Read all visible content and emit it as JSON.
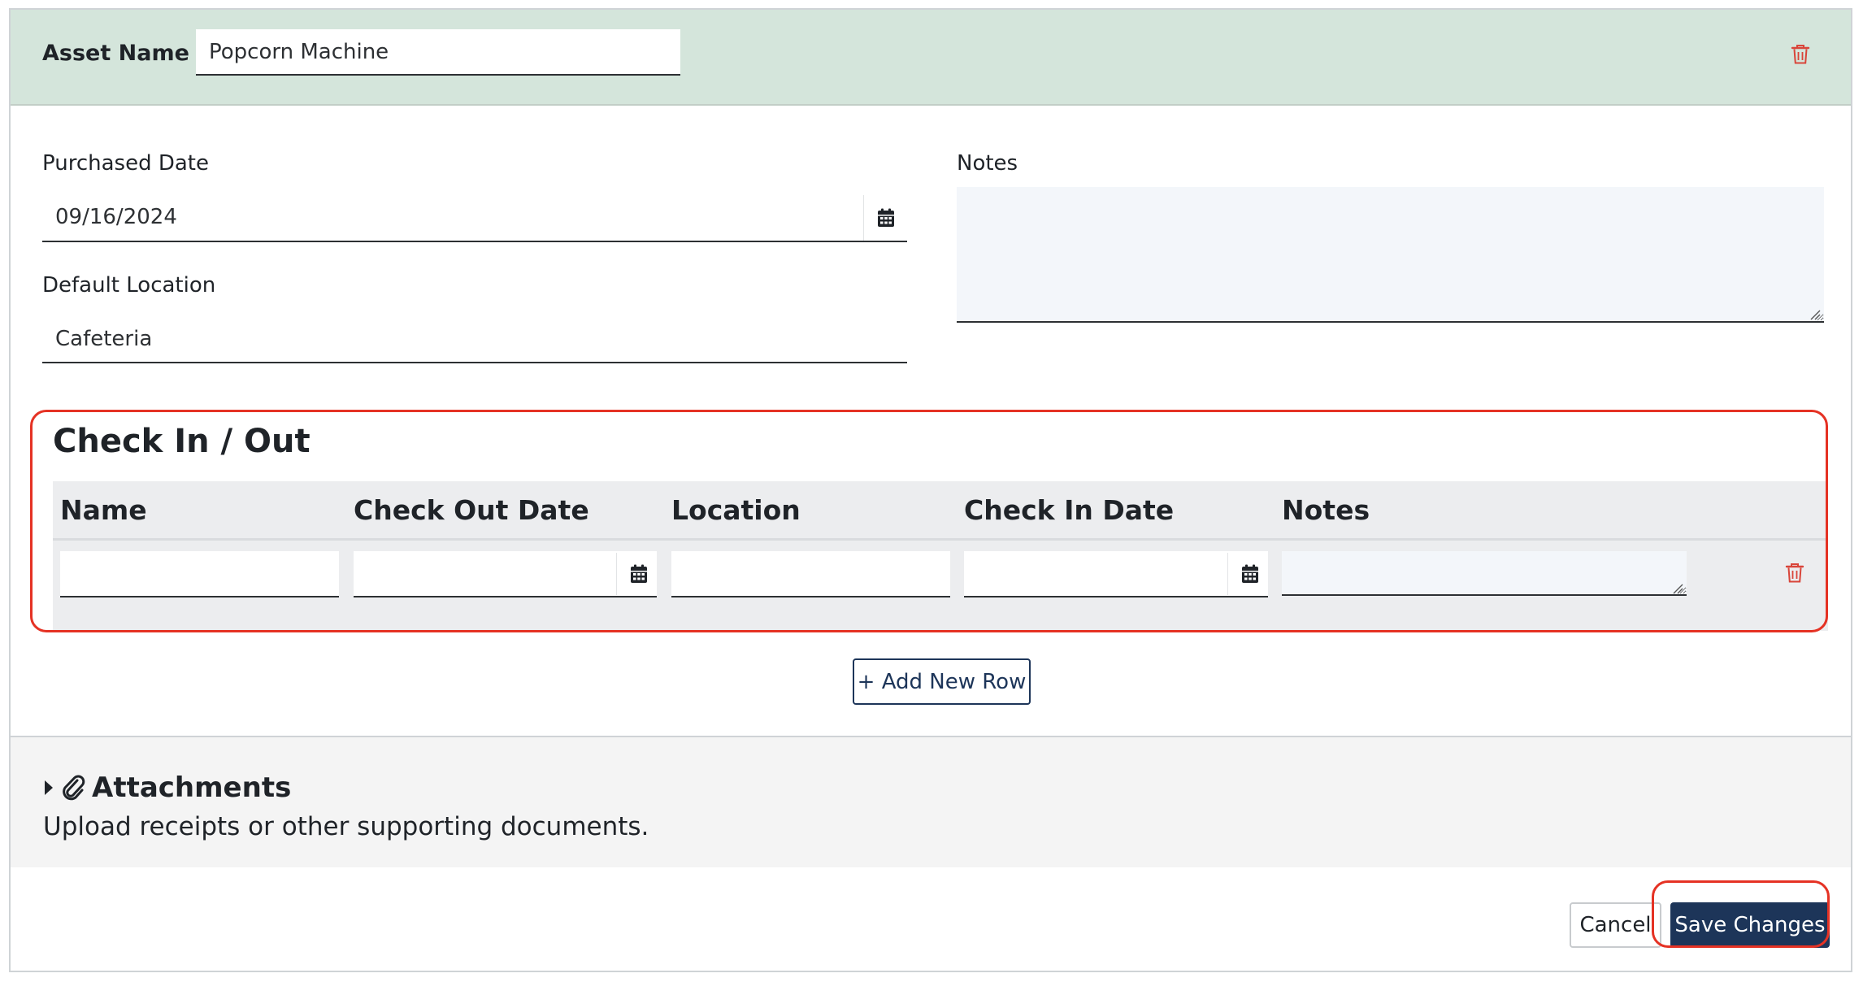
{
  "header": {
    "asset_name_label": "Asset Name",
    "asset_name_value": "Popcorn Machine",
    "delete_icon": "trash-icon"
  },
  "details": {
    "purchased_date_label": "Purchased Date",
    "purchased_date_value": "09/16/2024",
    "default_location_label": "Default Location",
    "default_location_value": "Cafeteria",
    "notes_label": "Notes",
    "notes_value": ""
  },
  "check_in_out": {
    "title": "Check In / Out",
    "columns": [
      "Name",
      "Check Out Date",
      "Location",
      "Check In Date",
      "Notes"
    ],
    "rows": [
      {
        "name": "",
        "check_out_date": "",
        "location": "",
        "check_in_date": "",
        "notes": ""
      }
    ],
    "add_row_label": "+ Add New Row"
  },
  "attachments": {
    "title": "Attachments",
    "description": "Upload receipts or other supporting documents.",
    "expanded": false
  },
  "footer": {
    "cancel_label": "Cancel",
    "save_label": "Save Changes"
  },
  "colors": {
    "header_bg": "#d4e5db",
    "primary": "#1d3559",
    "danger": "#d9453a",
    "highlight": "#e53224",
    "table_bg": "#ecedef"
  }
}
